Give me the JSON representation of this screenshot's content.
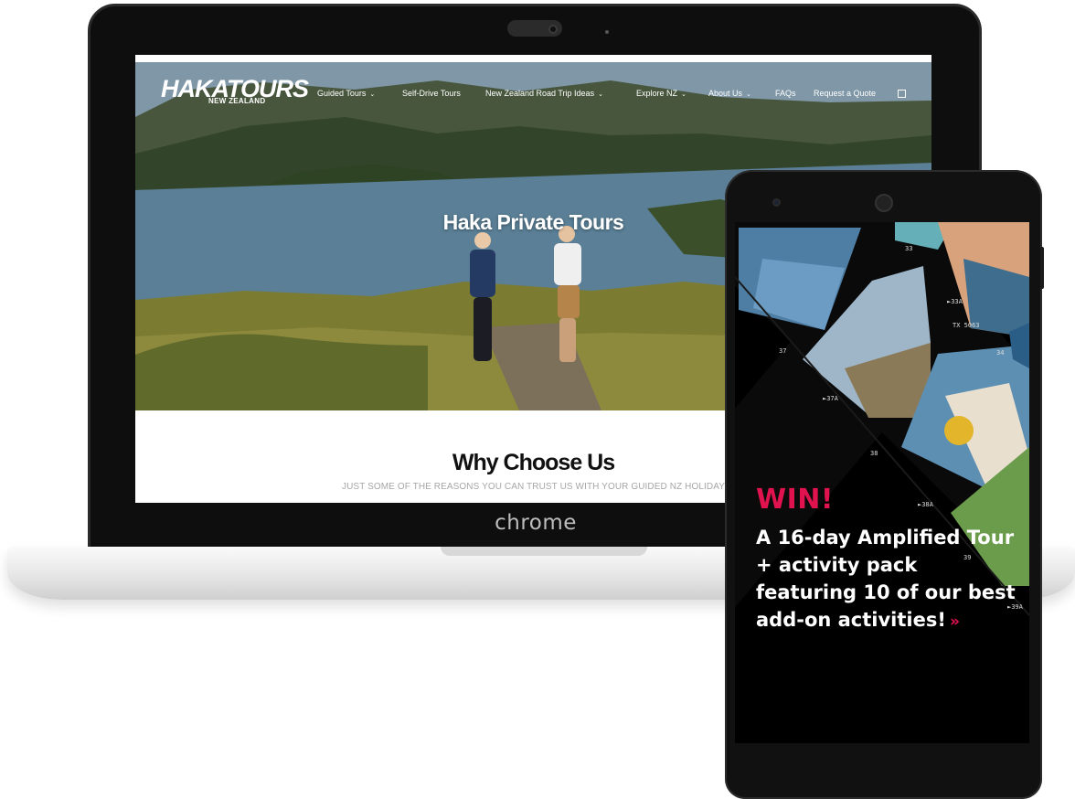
{
  "laptop": {
    "brand": "chrome"
  },
  "site": {
    "logo_main": "HAKATOURS",
    "logo_sub": "NEW ZEALAND",
    "nav": [
      {
        "label": "Guided Tours",
        "dropdown": true
      },
      {
        "label": "Self-Drive Tours",
        "dropdown": false
      },
      {
        "label": "New Zealand Road Trip Ideas",
        "dropdown": true
      },
      {
        "label": "Explore NZ",
        "dropdown": true
      },
      {
        "label": "About Us",
        "dropdown": true
      },
      {
        "label": "FAQs",
        "dropdown": false
      },
      {
        "label": "Request a Quote",
        "dropdown": false
      }
    ],
    "hero_title": "Haka Private Tours",
    "why_title": "Why Choose Us",
    "why_subtitle": "JUST SOME OF THE REASONS YOU CAN TRUST US WITH YOUR GUIDED NZ HOLIDAY"
  },
  "phone": {
    "win_label": "WIN!",
    "promo_text": "A 16-day Amplified Tour + activity pack featuring 10 of our best add-on activities!",
    "arrows": "»",
    "film_labels": [
      "33",
      "►33A",
      "TX 5063",
      "34",
      "37",
      "►37A",
      "38",
      "►38A",
      "39",
      "►39A"
    ]
  },
  "colors": {
    "accent": "#e1134f",
    "phone_bg": "#000000"
  }
}
